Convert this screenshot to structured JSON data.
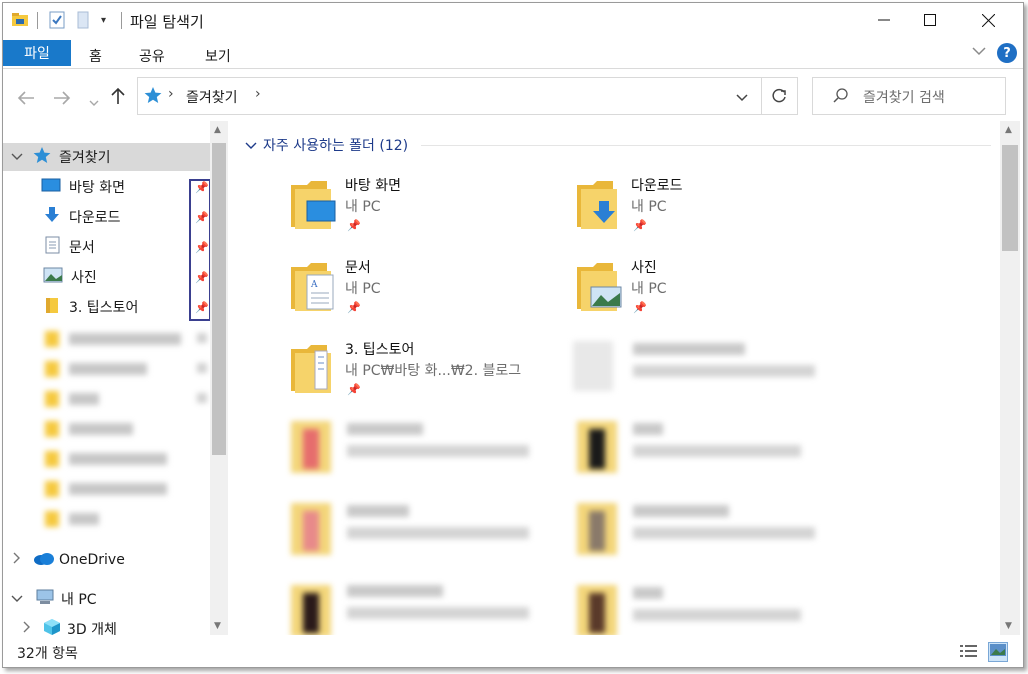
{
  "window": {
    "title": "파일 탐색기"
  },
  "ribbon": {
    "tabs": [
      "파일",
      "홈",
      "공유",
      "보기"
    ],
    "help": "?"
  },
  "address": {
    "path": "즐겨찾기",
    "search_placeholder": "즐겨찾기 검색"
  },
  "sidebar": {
    "quick_access": "즐겨찾기",
    "pinned": [
      "바탕 화면",
      "다운로드",
      "문서",
      "사진",
      "3. 팁스토어"
    ],
    "onedrive": "OneDrive",
    "thispc": "내 PC",
    "objects3d": "3D 개체"
  },
  "main": {
    "group_header": "자주 사용하는 폴더 (12)",
    "tiles": [
      {
        "name": "바탕 화면",
        "location": "내 PC"
      },
      {
        "name": "다운로드",
        "location": "내 PC"
      },
      {
        "name": "문서",
        "location": "내 PC"
      },
      {
        "name": "사진",
        "location": "내 PC"
      },
      {
        "name": "3. 팁스토어",
        "location": "내 PC₩바탕 화...₩2. 블로그"
      }
    ]
  },
  "status": {
    "item_count": "32개 항목"
  },
  "colors": {
    "accent": "#1979ca",
    "folder": "#f5c93f",
    "header": "#1e3b8a"
  }
}
